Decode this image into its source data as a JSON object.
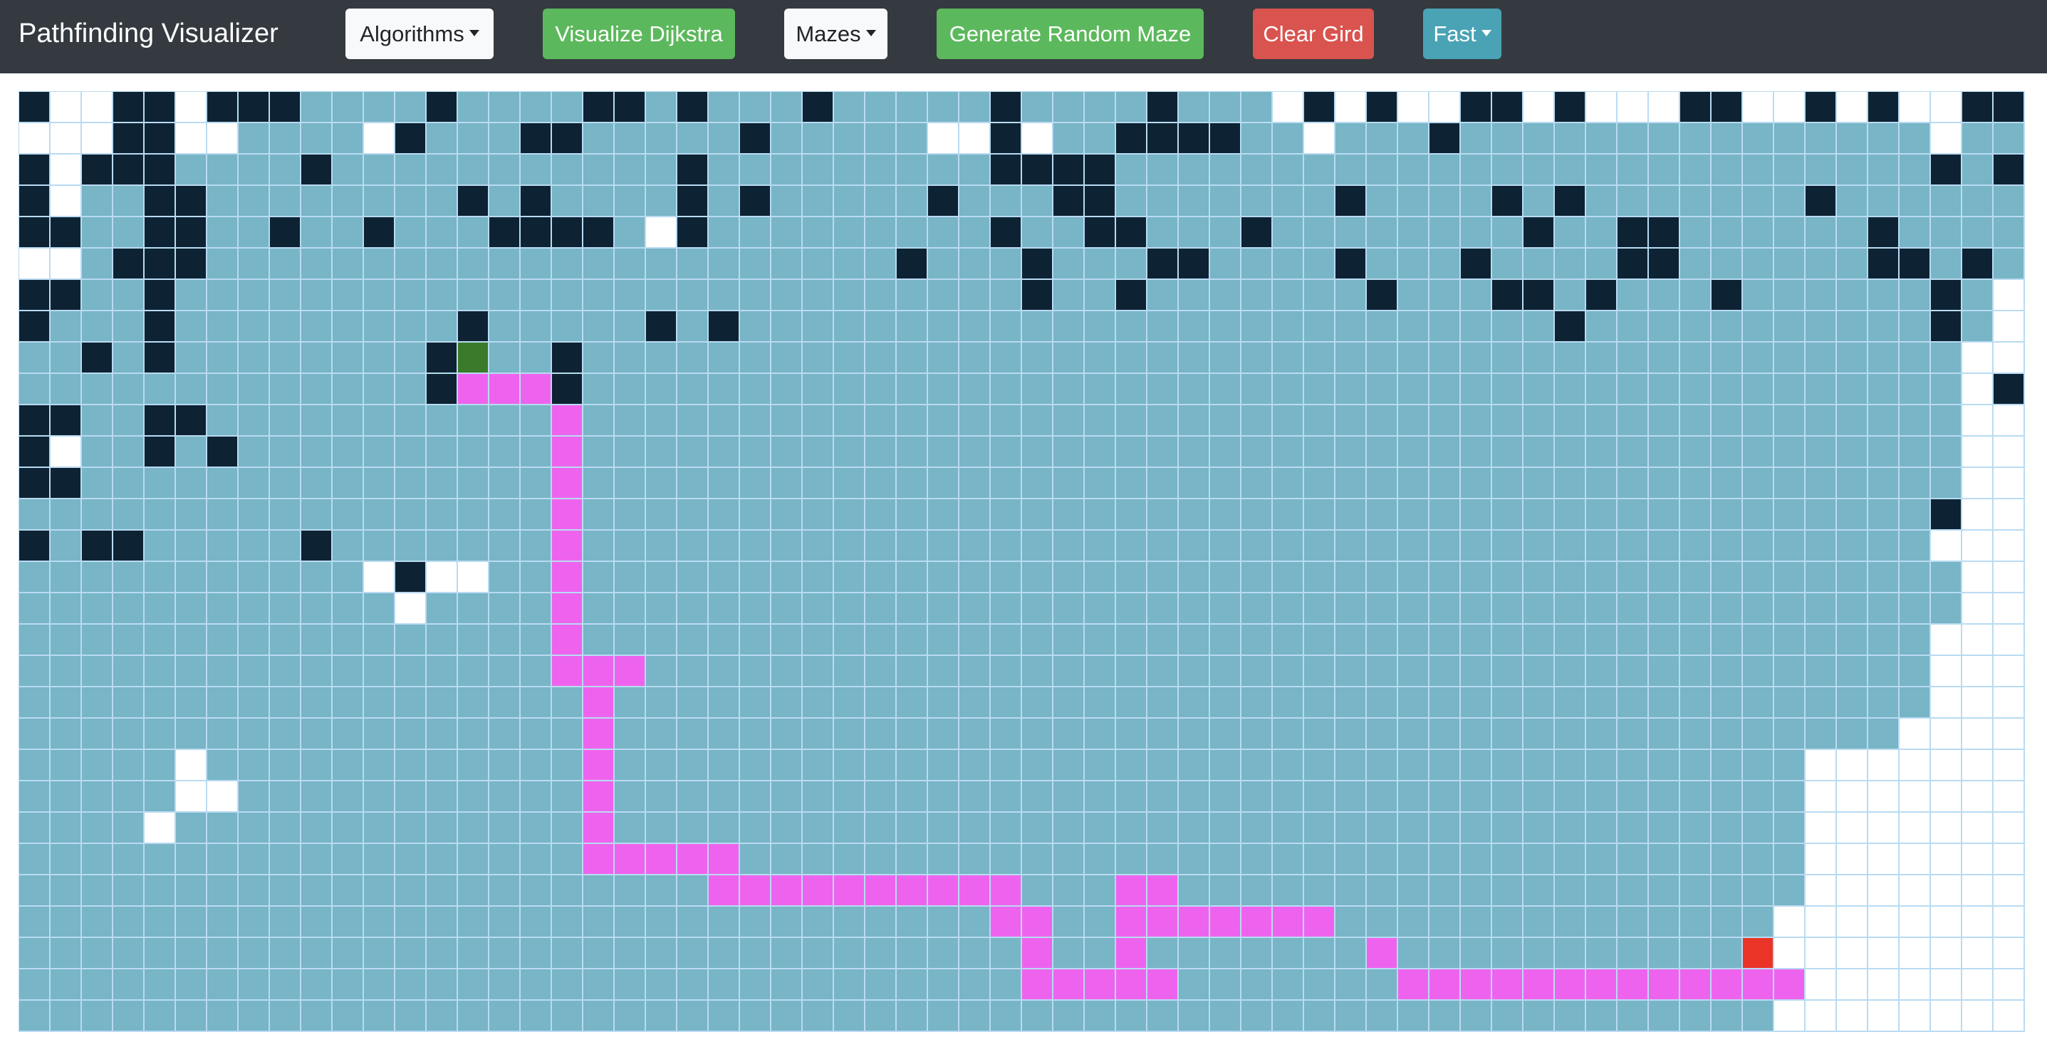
{
  "navbar": {
    "brand": "Pathfinding Visualizer",
    "algorithms_label": "Algorithms",
    "visualize_label": "Visualize Dijkstra",
    "mazes_label": "Mazes",
    "generate_label": "Generate Random Maze",
    "clear_label": "Clear Gird",
    "speed_label": "Fast"
  },
  "colors": {
    "navbar": "#343a40",
    "visited": "#78b5c6",
    "wall": "#0d2333",
    "path": "#ee63ee",
    "start": "#3a7a2a",
    "finish": "#ea3428",
    "unvisited": "#ffffff",
    "grid_line": "#b9dbf2"
  },
  "grid": {
    "rows": 30,
    "cols": 64,
    "legend": {
      ".": "unvisited",
      "v": "visited",
      "w": "wall",
      "p": "shortest-path",
      "s": "start",
      "f": "finish"
    },
    "cells": [
      "w..ww.wwwvvvvwvvvvwwvwvvvwvvvvvwvvvvwvvv.w.w..ww.w...ww..w.w..ww",
      "...ww..vvvv.wvvvwwvvvvvwvvvvv..w.vvwwwwvv.vvvwvvvvvvvvvvvvvvv.vv",
      "w.wwwvvvvwvvvvvvvvvvvwvvvvvvvvvwwwwvvvvvvvvvvvvvvvvvvvvvvvvvvwvw",
      "w.vvwwvvvvvvvvwvwvvvvwvwvvvvvwvvvwwvvvvvvvwvvvvwvwvvvvvvvwvvvvvv",
      "wwvvwwvvwvvwvvvwwwwv.wvvvvvvvvvwvvwwvvvwvvvvvvvvwvvwwvvvvvvwvvvv",
      "..vwwwvvvvvvvvvvvvvvvvvvvvvvwvvvwvvvwwvvvvwvvvwvvvvwwvvvvvvwwvwv",
      "wwvvwvvvvvvvvvvvvvvvvvvvvvvvvvvvwvvwvvvvvvvwvvvwwvwvvvwvvvvvvwv.",
      "wvvvwvvvvvvvvvwvvvvvwvwvvvvvvvvvvvvvvvvvvvvvvvvvvwvvvvvvvvvvvwv.",
      "vvwvwvvvvvvvvwsvvwvvvvvvvvvvvvvvvvvvvvvvvvvvvvvvvvvvvvvvvvvvvv..",
      "vvvvvvvvvvvvvwpppwvvvvvvvvvvvvvvvvvvvvvvvvvvvvvvvvvvvvvvvvvvvv.w",
      "wwvvwwvvvvvvvvvvvpvvvvvvvvvvvvvvvvvvvvvvvvvvvvvvvvvvvvvvvvvvvv..",
      "w.vvwvwvvvvvvvvvvpvvvvvvvvvvvvvvvvvvvvvvvvvvvvvvvvvvvvvvvvvvvv..",
      "wwvvvvvvvvvvvvvvvpvvvvvvvvvvvvvvvvvvvvvvvvvvvvvvvvvvvvvvvvvvvv..",
      "vvvvvvvvvvvvvvvvvpvvvvvvvvvvvvvvvvvvvvvvvvvvvvvvvvvvvvvvvvvvvw..",
      "wvwwvvvvvwvvvvvvvpvvvvvvvvvvvvvvvvvvvvvvvvvvvvvvvvvvvvvvvvvvv...",
      "vvvvvvvvvvv.w..vvpvvvvvvvvvvvvvvvvvvvvvvvvvvvvvvvvvvvvvvvvvvvv..",
      "vvvvvvvvvvvv.vvvvpvvvvvvvvvvvvvvvvvvvvvvvvvvvvvvvvvvvvvvvvvvvv..",
      "vvvvvvvvvvvvvvvvvpvvvvvvvvvvvvvvvvvvvvvvvvvvvvvvvvvvvvvvvvvvv...",
      "vvvvvvvvvvvvvvvvvpppvvvvvvvvvvvvvvvvvvvvvvvvvvvvvvvvvvvvvvvvv...",
      "vvvvvvvvvvvvvvvvvvpvvvvvvvvvvvvvvvvvvvvvvvvvvvvvvvvvvvvvvvvvv...",
      "vvvvvvvvvvvvvvvvvvpvvvvvvvvvvvvvvvvvvvvvvvvvvvvvvvvvvvvvvvvv....",
      "vvvvv.vvvvvvvvvvvvpvvvvvvvvvvvvvvvvvvvvvvvvvvvvvvvvvvvvvv.......",
      "vvvvv..vvvvvvvvvvvpvvvvvvvvvvvvvvvvvvvvvvvvvvvvvvvvvvvvvv.......",
      "vvvv.vvvvvvvvvvvvvpvvvvvvvvvvvvvvvvvvvvvvvvvvvvvvvvvvvvvv.......",
      "vvvvvvvvvvvvvvvvvvpppppvvvvvvvvvvvvvvvvvvvvvvvvvvvvvvvvvv.......",
      "vvvvvvvvvvvvvvvvvvvvvvppppppppppvvvppvvvvvvvvvvvvvvvvvvvv.......",
      "vvvvvvvvvvvvvvvvvvvvvvvvvvvvvvvppvvpppppppvvvvvvvvvvvvvv........",
      "vvvvvvvvvvvvvvvvvvvvvvvvvvvvvvvvpvvpvvvvvvvpvvvvvvvvvvvf........",
      "vvvvvvvvvvvvvvvvvvvvvvvvvvvvvvvvpppppvvvvvvvppppppppppppp.......",
      "vvvvvvvvvvvvvvvvvvvvvvvvvvvvvvvvvvvvvvvvvvvvvvvvvvvvvvvv........"
    ]
  }
}
